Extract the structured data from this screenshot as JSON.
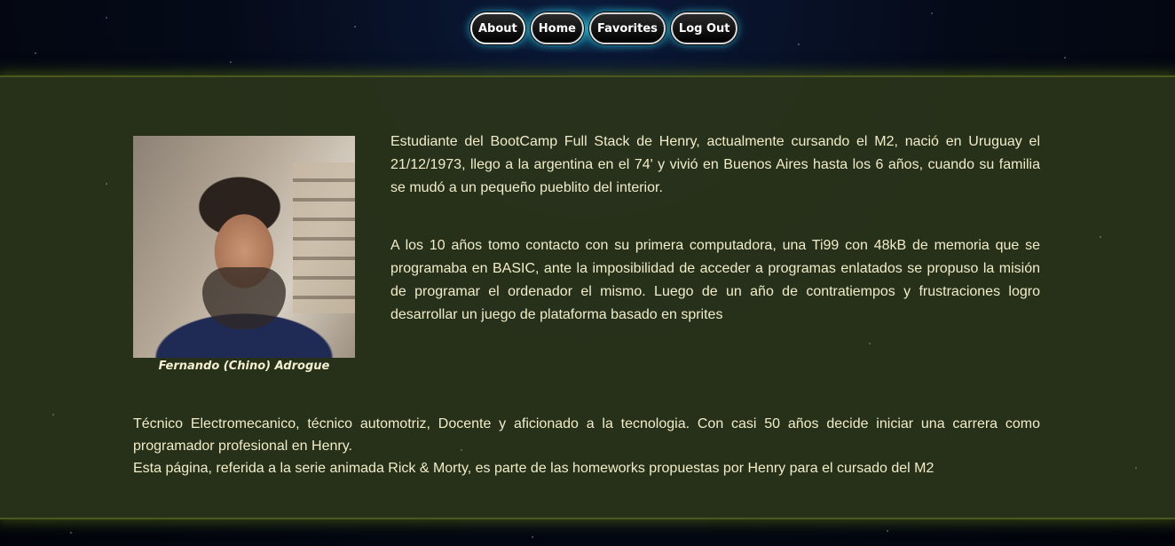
{
  "nav": {
    "items": [
      {
        "label": "About",
        "active": true
      },
      {
        "label": "Home",
        "active": false
      },
      {
        "label": "Favorites",
        "active": false
      },
      {
        "label": "Log Out",
        "active": false
      }
    ]
  },
  "about": {
    "photo_caption": "Fernando (Chino) Adrogue",
    "paragraphs": [
      "Estudiante del BootCamp Full Stack de Henry, actualmente cursando el M2, nació en Uruguay el 21/12/1973, llego a la argentina en el 74' y vivió en Buenos Aires hasta los 6 años, cuando su familia se mudó a un pequeño pueblito del interior.",
      "A los 10 años tomo contacto con su primera computadora, una Ti99 con 48kB de memoria que se programaba en BASIC, ante la imposibilidad de acceder a programas enlatados se propuso la misión de programar el ordenador el mismo. Luego de un año de contratiempos y frustraciones logro desarrollar un juego de plataforma basado en sprites"
    ],
    "bottom_paragraphs": [
      "Técnico Electromecanico, técnico automotriz, Docente y aficionado a la tecnologia. Con casi 50 años decide iniciar una carrera como programador profesional en Henry.",
      "Esta página, referida a la serie animada Rick & Morty, es parte de las homeworks propuestas por Henry para el cursado del M2"
    ]
  },
  "colors": {
    "panel_background": "#2a341a",
    "text": "#f1edc9",
    "nav_glow": "#28dcf0",
    "nav_button": "#000000"
  }
}
